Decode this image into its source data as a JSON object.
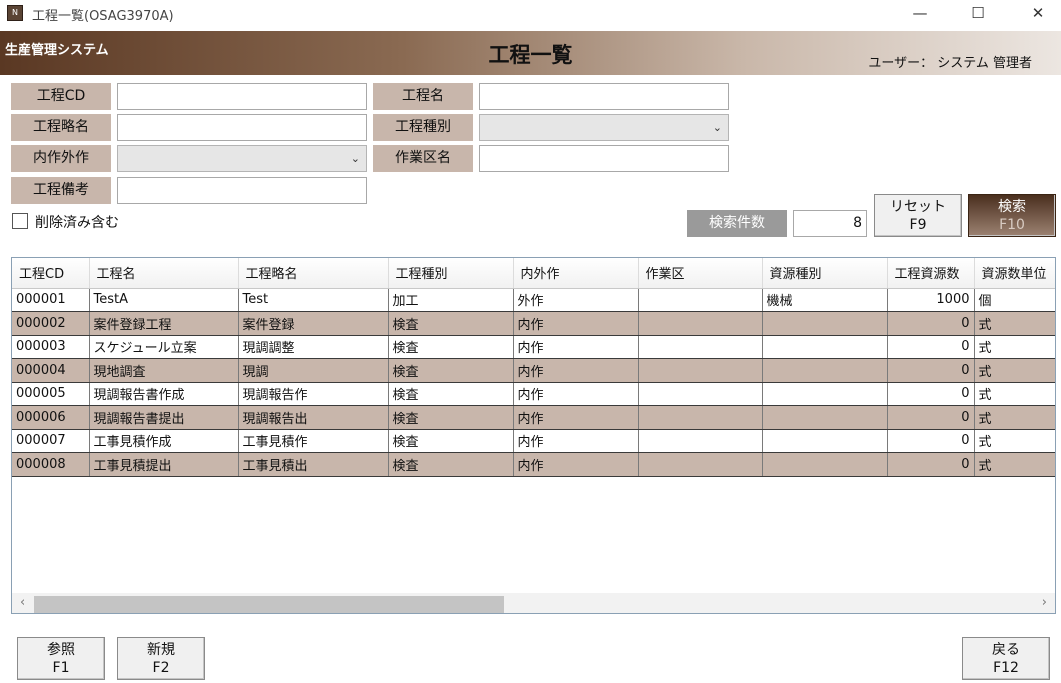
{
  "window": {
    "icon_text": "N",
    "title": "工程一覧(OSAG3970A)",
    "minimize_glyph": "—",
    "maximize_glyph": "☐",
    "close_glyph": "✕"
  },
  "header": {
    "system_name": "生産管理システム",
    "page_title": "工程一覧",
    "user": "ユーザー：  システム 管理者"
  },
  "form": {
    "process_cd_label": "工程CD",
    "process_cd_value": "",
    "process_name_label": "工程名",
    "process_name_value": "",
    "short_name_label": "工程略名",
    "short_name_value": "",
    "process_type_label": "工程種別",
    "process_type_value": "",
    "in_out_label": "内作外作",
    "in_out_value": "",
    "work_area_label": "作業区名",
    "work_area_value": "",
    "remarks_label": "工程備考",
    "remarks_value": "",
    "include_deleted_label": "削除済み含む",
    "count_label": "検索件数",
    "count_value": "8"
  },
  "buttons": {
    "reset": "リセット",
    "reset_key": "F9",
    "search": "検索",
    "search_key": "F10",
    "refer": "参照",
    "refer_key": "F1",
    "new": "新規",
    "new_key": "F2",
    "back": "戻る",
    "back_key": "F12"
  },
  "table": {
    "columns": [
      "工程CD",
      "工程名",
      "工程略名",
      "工程種別",
      "内外作",
      "作業区",
      "資源種別",
      "工程資源数",
      "資源数単位"
    ],
    "rows": [
      [
        "000001",
        "TestA",
        "Test",
        "加工",
        "外作",
        "",
        "機械",
        "1000",
        "個"
      ],
      [
        "000002",
        "案件登録工程",
        "案件登録",
        "検査",
        "内作",
        "",
        "",
        "0",
        "式"
      ],
      [
        "000003",
        "スケジュール立案",
        "現調調整",
        "検査",
        "内作",
        "",
        "",
        "0",
        "式"
      ],
      [
        "000004",
        "現地調査",
        "現調",
        "検査",
        "内作",
        "",
        "",
        "0",
        "式"
      ],
      [
        "000005",
        "現調報告書作成",
        "現調報告作",
        "検査",
        "内作",
        "",
        "",
        "0",
        "式"
      ],
      [
        "000006",
        "現調報告書提出",
        "現調報告出",
        "検査",
        "内作",
        "",
        "",
        "0",
        "式"
      ],
      [
        "000007",
        "工事見積作成",
        "工事見積作",
        "検査",
        "内作",
        "",
        "",
        "0",
        "式"
      ],
      [
        "000008",
        "工事見積提出",
        "工事見積出",
        "検査",
        "内作",
        "",
        "",
        "0",
        "式"
      ]
    ],
    "scroll_left": "‹",
    "scroll_right": "›"
  },
  "colors": {
    "label_bg": "#c8b6ab",
    "alt_row_bg": "#c8b6ab",
    "header_dark": "#5a3823"
  }
}
